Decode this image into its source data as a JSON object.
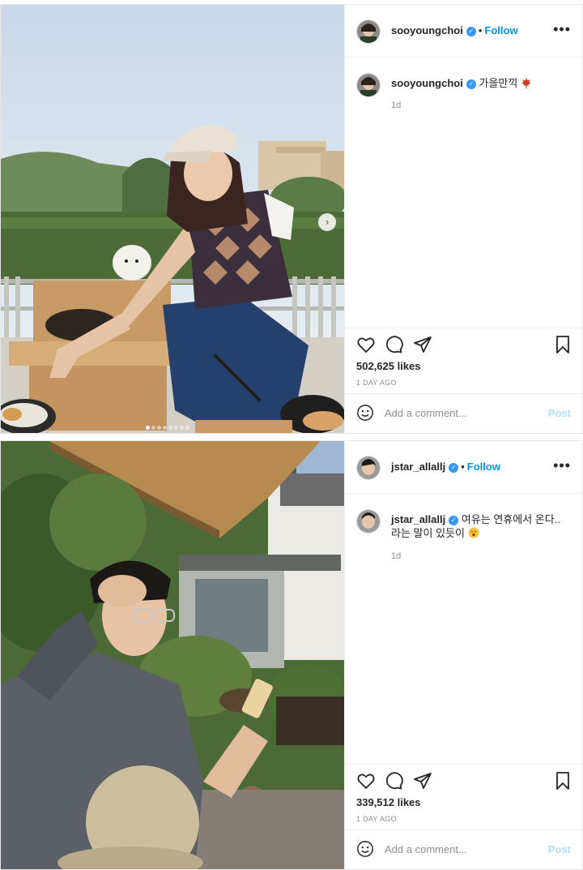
{
  "posts": [
    {
      "username": "sooyoungchoi",
      "follow_label": "Follow",
      "caption_text": "가을만끽",
      "caption_emoji": "maple-leaf-emoji",
      "caption_age": "1d",
      "likes": "502,625 likes",
      "date": "1 DAY AGO",
      "comment_placeholder": "Add a comment...",
      "post_label": "Post",
      "carousel_dots": 8,
      "carousel_active_index": 0
    },
    {
      "username": "jstar_allallj",
      "follow_label": "Follow",
      "caption_text": "여유는 연휴에서 온다.. 라는 말이 있듯이",
      "caption_emoji": "surprised-face-emoji",
      "caption_age": "1d",
      "likes": "339,512 likes",
      "date": "1 DAY AGO",
      "comment_placeholder": "Add a comment...",
      "post_label": "Post"
    }
  ],
  "colors": {
    "follow_blue": "#0095f6",
    "verified_blue": "#3897f0",
    "muted_gray": "#8e8e8e",
    "post_disabled": "#b2dffc"
  }
}
